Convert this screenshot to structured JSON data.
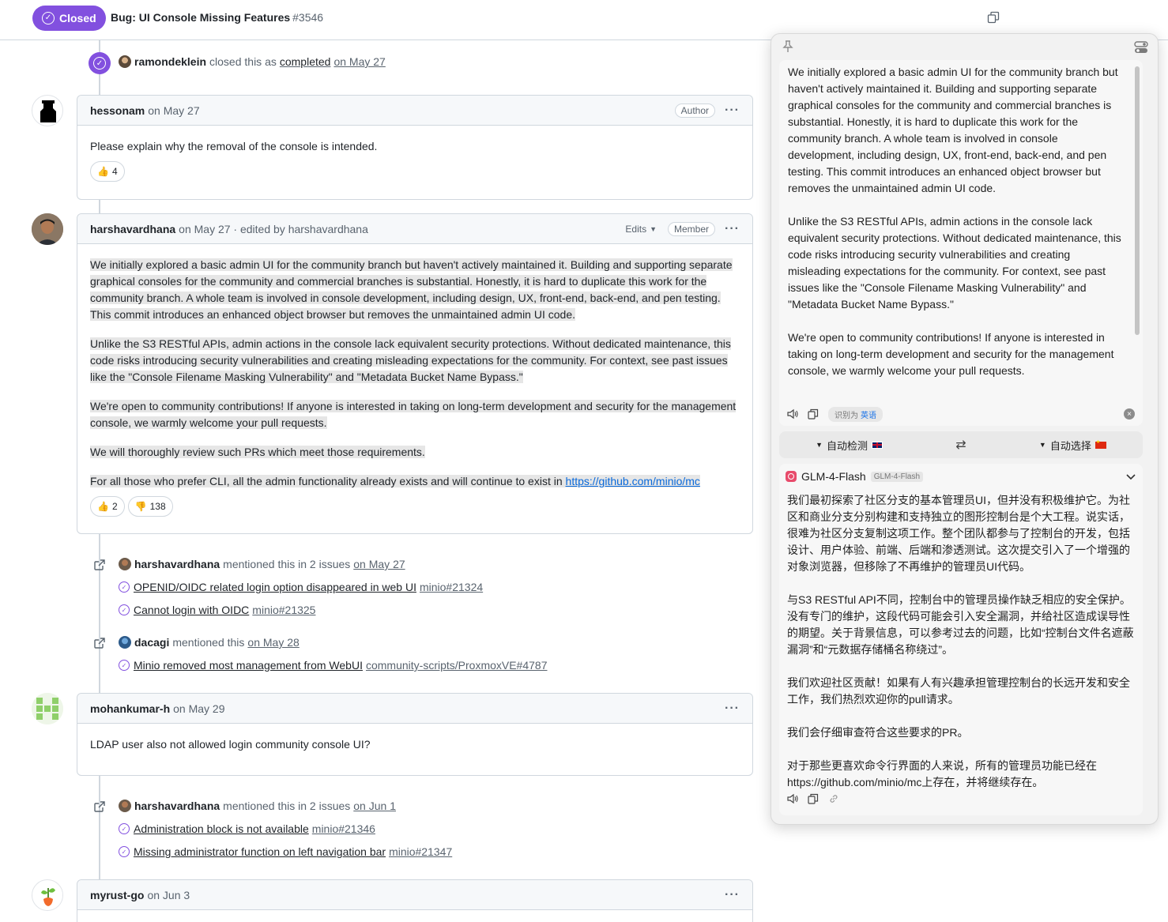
{
  "header": {
    "state_label": "Closed",
    "title": "Bug: UI Console Missing Features",
    "number": "#3546"
  },
  "close_event": {
    "user": "ramondeklein",
    "text": "closed this as",
    "status": "completed",
    "date": "on May 27"
  },
  "comments": [
    {
      "author": "hessonam",
      "date": "on May 27",
      "badge": "Author",
      "body": [
        "Please explain why the removal of the console is intended."
      ],
      "reactions": [
        {
          "emoji": "👍",
          "count": "4"
        }
      ]
    },
    {
      "author": "harshavardhana",
      "date": "on May 27 · edited by harshavardhana",
      "edits_label": "Edits",
      "badge": "Member",
      "body": [
        "We initially explored a basic admin UI for the community branch but haven't actively maintained it. Building and supporting separate graphical consoles for the community and commercial branches is substantial. Honestly, it is hard to duplicate this work for the community branch. A whole team is involved in console development, including design, UX, front-end, back-end, and pen testing. This commit introduces an enhanced object browser but removes the unmaintained admin UI code.",
        "Unlike the S3 RESTful APIs, admin actions in the console lack equivalent security protections. Without dedicated maintenance, this code risks introducing security vulnerabilities and creating misleading expectations for the community. For context, see past issues like the \"Console Filename Masking Vulnerability\" and \"Metadata Bucket Name Bypass.\"",
        "We're open to community contributions! If anyone is interested in taking on long-term development and security for the management console, we warmly welcome your pull requests.",
        "We will thoroughly review such PRs which meet those requirements."
      ],
      "body_last_prefix": "For all those who prefer CLI, all the admin functionality already exists and will continue to exist in",
      "body_link": "https://github.com/minio/mc",
      "reactions": [
        {
          "emoji": "👍",
          "count": "2"
        },
        {
          "emoji": "👎",
          "count": "138"
        }
      ]
    },
    {
      "author": "mohankumar-h",
      "date": "on May 29",
      "body": [
        "LDAP user also not allowed login community console UI?"
      ]
    },
    {
      "author": "myrust-go",
      "date": "on Jun 3"
    }
  ],
  "mentions": [
    {
      "user": "harshavardhana",
      "text": "mentioned this in 2 issues",
      "date": "on May 27",
      "refs": [
        {
          "title": "OPENID/OIDC related login option disappeared in web UI",
          "num": "minio#21324"
        },
        {
          "title": "Cannot login with OIDC",
          "num": "minio#21325"
        }
      ]
    },
    {
      "user": "dacagi",
      "text": "mentioned this",
      "date": "on May 28",
      "refs": [
        {
          "title": "Minio removed most management from WebUI",
          "num": "community-scripts/ProxmoxVE#4787"
        }
      ]
    },
    {
      "user": "harshavardhana",
      "text": "mentioned this in 2 issues",
      "date": "on Jun 1",
      "refs": [
        {
          "title": "Administration block is not available",
          "num": "minio#21346"
        },
        {
          "title": "Missing administrator function on left navigation bar",
          "num": "minio#21347"
        }
      ]
    }
  ],
  "translator": {
    "source_paragraphs": [
      "We initially explored a basic admin UI for the community branch but haven't actively maintained it. Building and supporting separate graphical consoles for the community and commercial branches is substantial. Honestly, it is hard to duplicate this work for the community branch. A whole team is involved in console development, including design, UX, front-end, back-end, and pen testing. This commit introduces an enhanced object browser but removes the unmaintained admin UI code.",
      "Unlike the S3 RESTful APIs, admin actions in the console lack equivalent security protections. Without dedicated maintenance, this code risks introducing security vulnerabilities and creating misleading expectations for the community. For context, see past issues like the \"Console Filename Masking Vulnerability\" and \"Metadata Bucket Name Bypass.\"",
      "We're open to community contributions! If anyone is interested in taking on long-term development and security for the management console, we warmly welcome your pull requests."
    ],
    "detected_prefix": "识别为",
    "detected_lang": "英语",
    "source_lang": "自动检测",
    "target_lang": "自动选择",
    "model_name": "GLM-4-Flash",
    "model_tag": "GLM-4-Flash",
    "output_paragraphs": [
      "我们最初探索了社区分支的基本管理员UI，但并没有积极维护它。为社区和商业分支分别构建和支持独立的图形控制台是个大工程。说实话，很难为社区分支复制这项工作。整个团队都参与了控制台的开发，包括设计、用户体验、前端、后端和渗透测试。这次提交引入了一个增强的对象浏览器，但移除了不再维护的管理员UI代码。",
      "与S3 RESTful API不同，控制台中的管理员操作缺乏相应的安全保护。没有专门的维护，这段代码可能会引入安全漏洞，并给社区造成误导性的期望。关于背景信息，可以参考过去的问题，比如“控制台文件名遮蔽漏洞”和“元数据存储桶名称绕过”。",
      "我们欢迎社区贡献！如果有人有兴趣承担管理控制台的长远开发和安全工作，我们热烈欢迎你的pull请求。",
      "我们会仔细审查符合这些要求的PR。",
      "对于那些更喜欢命令行界面的人来说，所有的管理员功能已经在https://github.com/minio/mc上存在，并将继续存在。"
    ]
  },
  "colors": {
    "closed_purple": "#8250df",
    "border": "#d0d7de",
    "muted": "#59636e",
    "link": "#0969da"
  }
}
